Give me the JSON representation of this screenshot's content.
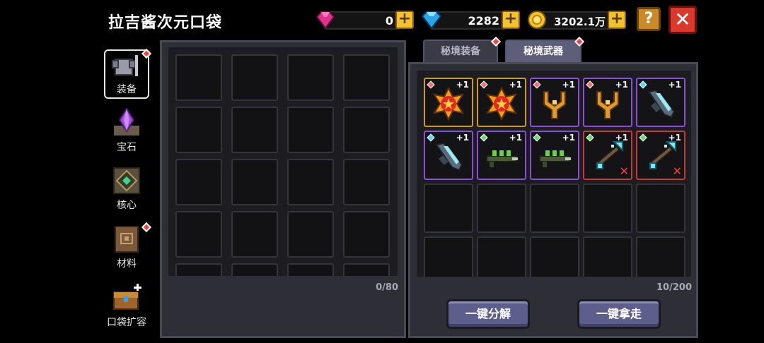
{
  "header": {
    "title": "拉吉酱次元口袋"
  },
  "currency": {
    "pink_gem": {
      "value": "0",
      "icon": "pink-gem-icon"
    },
    "blue_gem": {
      "value": "2282",
      "icon": "blue-diamond-icon"
    },
    "coin": {
      "value": "3202.1万",
      "icon": "gold-coin-icon"
    },
    "plus_symbol": "+"
  },
  "controls": {
    "help": "?",
    "close": "✕"
  },
  "sidebar": {
    "items": [
      {
        "label": "装备",
        "icon": "armor-icon"
      },
      {
        "label": "宝石",
        "icon": "crystal-icon"
      },
      {
        "label": "核心",
        "icon": "core-icon"
      },
      {
        "label": "材料",
        "icon": "book-icon"
      },
      {
        "label": "口袋扩容",
        "icon": "treasure-chest-icon"
      }
    ]
  },
  "left_panel": {
    "count": "0/80"
  },
  "right_panel": {
    "tabs": [
      {
        "label": "秘境装备"
      },
      {
        "label": "秘境武器"
      }
    ],
    "count": "10/200",
    "items": [
      {
        "name": "red-gold-medallion",
        "level": "+1",
        "rarity": "gold"
      },
      {
        "name": "red-gold-medallion",
        "level": "+1",
        "rarity": "gold"
      },
      {
        "name": "golden-slingshot",
        "level": "+1",
        "rarity": "purple"
      },
      {
        "name": "golden-slingshot",
        "level": "+1",
        "rarity": "purple"
      },
      {
        "name": "ice-gun",
        "level": "+1",
        "rarity": "purple"
      },
      {
        "name": "ice-gun",
        "level": "+1",
        "rarity": "purple"
      },
      {
        "name": "green-rifle",
        "level": "+1",
        "rarity": "purple"
      },
      {
        "name": "green-rifle",
        "level": "+1",
        "rarity": "purple"
      },
      {
        "name": "crystal-crossbow",
        "level": "+1",
        "rarity": "red",
        "mark": "✕"
      },
      {
        "name": "crystal-crossbow",
        "level": "+1",
        "rarity": "red",
        "mark": "✕"
      }
    ]
  },
  "buttons": {
    "dismantle_all": "一键分解",
    "take_all": "一键拿走"
  },
  "colors": {
    "gold_border": "#c99a2b",
    "purple_border": "#8a4fd3",
    "red_border": "#c23b3b",
    "accent_yellow": "#f2c22c",
    "close_red": "#d93a2d"
  }
}
